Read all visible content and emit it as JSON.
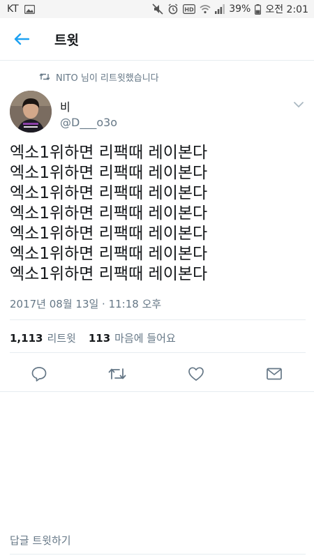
{
  "status_bar": {
    "carrier": "KT",
    "battery": "39%",
    "time": "오전 2:01",
    "icons": [
      "gallery-icon",
      "mute-icon",
      "alarm-icon",
      "hd-icon",
      "wifi-icon",
      "signal-icon",
      "battery-icon"
    ]
  },
  "header": {
    "title": "트윗",
    "back_icon": "back-arrow-icon",
    "accent_color": "#1da1f2"
  },
  "retweet": {
    "text": "NITO 님이 리트윗했습니다",
    "icon": "retweet-icon"
  },
  "author": {
    "name": "비",
    "handle": "@D___o3o",
    "avatar": "avatar-photo",
    "menu_icon": "chevron-down-icon"
  },
  "tweet": {
    "lines": [
      "엑소1위하면 리팩때 레이본다",
      "엑소1위하면 리팩때 레이본다",
      "엑소1위하면 리팩때 레이본다",
      "엑소1위하면 리팩때 레이본다",
      "엑소1위하면 리팩때 레이본다",
      "엑소1위하면 리팩때 레이본다",
      "엑소1위하면 리팩때 레이본다"
    ],
    "timestamp": "2017년 08월 13일 · 11:18 오후"
  },
  "stats": {
    "retweet_count": "1,113",
    "retweet_label": "리트윗",
    "like_count": "113",
    "like_label": "마음에 들어요"
  },
  "actions": [
    "reply-icon",
    "retweet-icon",
    "heart-icon",
    "mail-icon"
  ],
  "reply_bar": {
    "placeholder": "답글 트윗하기"
  }
}
